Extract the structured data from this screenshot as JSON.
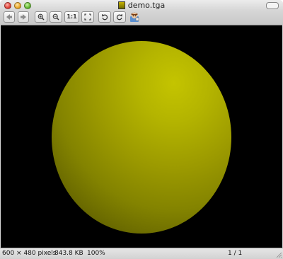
{
  "window": {
    "title": "demo.tga",
    "traffic_lights": [
      "close",
      "minimize",
      "maximize"
    ]
  },
  "toolbar": {
    "buttons": [
      {
        "name": "back-button",
        "icon": "arrow-left-icon"
      },
      {
        "name": "forward-button",
        "icon": "arrow-right-icon"
      },
      {
        "name": "zoom-in-button",
        "icon": "zoom-in-icon"
      },
      {
        "name": "zoom-out-button",
        "icon": "zoom-out-icon"
      },
      {
        "name": "actual-size-button",
        "label": "1:1"
      },
      {
        "name": "fit-window-button",
        "icon": "fit-icon"
      },
      {
        "name": "rotate-left-button",
        "icon": "rotate-ccw-icon"
      },
      {
        "name": "rotate-right-button",
        "icon": "rotate-cw-icon"
      }
    ],
    "actual_size_label": "1:1"
  },
  "image": {
    "background": "#000000",
    "subject_color": "#b4b400"
  },
  "status": {
    "dimensions": "600 × 480 pixels",
    "file_size": "843.8 KB",
    "zoom": "100%",
    "page": "1 / 1"
  }
}
